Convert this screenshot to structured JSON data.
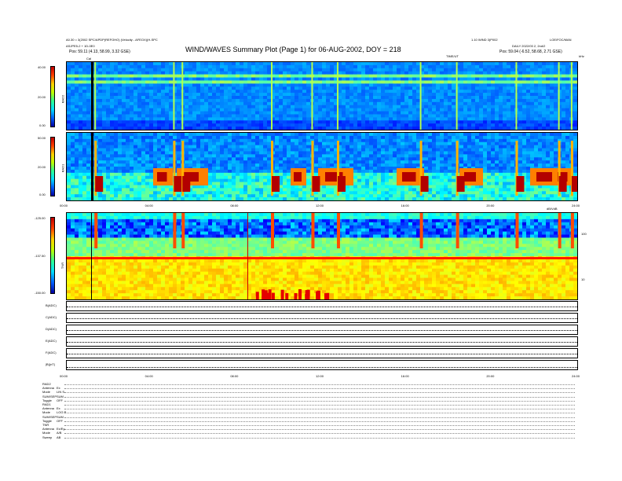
{
  "header": {
    "left_line1": "A0.30 = 3(2002 SPC/APDP(REFOHO) (Velocity - AFEOX)(H-SPC",
    "left_line2": "ASJPE5-2 + 1D-0E0",
    "left_pos": "Pos:    59.11 (4.13, 58.99, 3.32 GSE)",
    "title": "WIND/WAVES Summary Plot (Page 1) for 06-AUG-2002, DOY = 218",
    "right_line1": "1.10 WIND 3)P002",
    "right_line2": "LOE/FOC/MAN",
    "right_line3": "DAILY 2022/03 2, 2nd/2",
    "right_pos": "Pos:    59.04 (-6.52, 58.68, 2.71 GSE)",
    "time_label": "TIME/UT",
    "khz_label": "kHz",
    "cal_label": "Cal"
  },
  "panels": {
    "rad2": {
      "label": "RAD2",
      "ticks": [
        "40.00",
        "20.00",
        "0.00"
      ]
    },
    "rad1": {
      "label": "RAD1",
      "ticks": [
        "50.00",
        "20.00",
        "0.00"
      ]
    },
    "tnr": {
      "label": "TNR",
      "ticks": [
        "-125.00",
        "-137.50",
        "-150.00"
      ],
      "right_ticks": [
        "100",
        "10"
      ],
      "db_label": "dB/VdB"
    }
  },
  "time_ticks": [
    "00:00",
    "04:00",
    "08:00",
    "12:00",
    "16:00",
    "20:00",
    "24:00"
  ],
  "bottom_ticks": [
    "00:00",
    "04:00",
    "08:00",
    "12:00",
    "16:00",
    "20:00",
    "24:00"
  ],
  "traces": [
    {
      "label": "B(ADC)"
    },
    {
      "label": "C(ADC)"
    },
    {
      "label": "D(ADC)"
    },
    {
      "label": "E(ADC)"
    },
    {
      "label": "F(ADC)"
    },
    {
      "label": "|B|(nT)"
    }
  ],
  "footer": [
    {
      "k": "RAD2",
      "v": ""
    },
    {
      "k": "Antenna",
      "v": "Ex"
    },
    {
      "k": "Mode",
      "v": "LIN S"
    },
    {
      "k": "SUM/SEP",
      "v": "SUM"
    },
    {
      "k": "Toggle",
      "v": "OFF"
    },
    {
      "k": "RAD1",
      "v": ""
    },
    {
      "k": "Antenna",
      "v": "Ex"
    },
    {
      "k": "Mode",
      "v": "LOG R"
    },
    {
      "k": "SUM/SEP",
      "v": "SUM"
    },
    {
      "k": "Toggle",
      "v": "OFF"
    },
    {
      "k": "TNR",
      "v": ""
    },
    {
      "k": "Antenna",
      "v": "Ex/Ey"
    },
    {
      "k": "Mode",
      "v": "A/B"
    },
    {
      "k": "Sweep",
      "v": "AB"
    }
  ],
  "chart_data": {
    "type": "heatmap",
    "title": "WIND/WAVES Summary Plot (Page 1) for 06-AUG-2002, DOY = 218",
    "x_range_hours": [
      0,
      24
    ],
    "panels": [
      {
        "name": "RAD2",
        "ylim": [
          0,
          40
        ],
        "yticks": [
          0,
          20,
          40
        ],
        "color_scale": "jet"
      },
      {
        "name": "RAD1",
        "ylim": [
          0,
          50
        ],
        "yticks": [
          0,
          20,
          50
        ],
        "color_scale": "jet"
      },
      {
        "name": "TNR",
        "ylim": [
          -150,
          -125
        ],
        "yticks": [
          -150,
          -137.5,
          -125
        ],
        "right_axis_ticks": [
          10,
          100
        ],
        "color_scale": "jet"
      }
    ],
    "bursts_hours": [
      1.3,
      5.0,
      5.4,
      9.6,
      11.5,
      12.7,
      16.6,
      18.3,
      21.1,
      23.1,
      23.7
    ]
  }
}
